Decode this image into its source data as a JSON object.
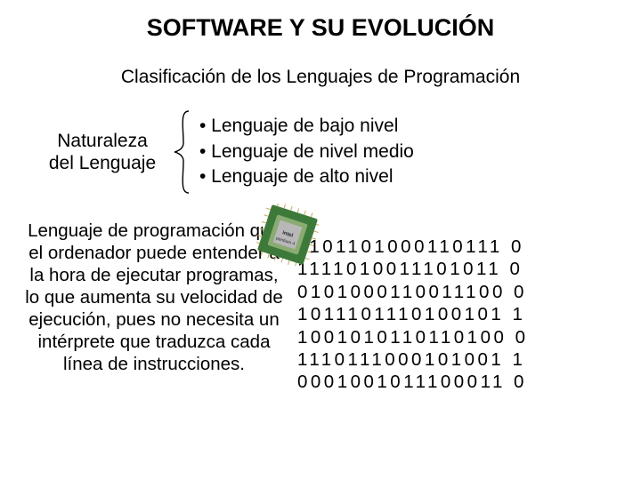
{
  "title": "SOFTWARE Y SU EVOLUCIÓN",
  "subtitle": "Clasificación de los Lenguajes de Programación",
  "nature_l1": "Naturaleza",
  "nature_l2": "del Lenguaje",
  "level1": "• Lenguaje de bajo nivel",
  "level2": "• Lenguaje de nivel medio",
  "level3": "• Lenguaje de alto nivel",
  "description": "Lenguaje de programación que el ordenador puede entender a la hora de ejecutar programas, lo que aumenta su velocidad de ejecución, pues no necesita un intérprete que traduzca cada línea de instrucciones.",
  "bin1": "1101101000110111 0",
  "bin2": "1111010011101011 0",
  "bin3": "0101000110011100 0",
  "bin4": "1011101110100101 1",
  "bin5": "1001010110110100 0",
  "bin6": "1110111000101001 1",
  "bin7": "0001001011100011 0",
  "chip_label": "intel-pentium-4-cpu"
}
